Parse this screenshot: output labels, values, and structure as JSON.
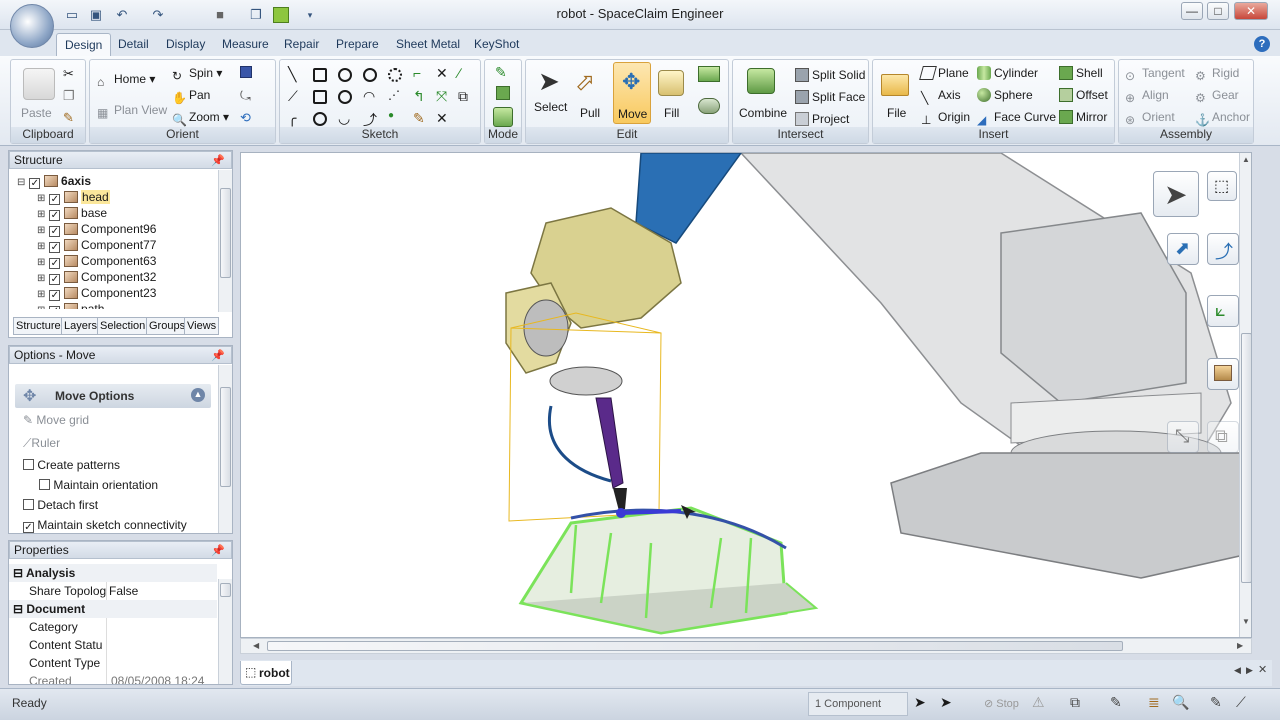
{
  "window": {
    "title": "robot - SpaceClaim Engineer",
    "minimize": "—",
    "maximize": "□",
    "close": "✕"
  },
  "quick_access": [
    "open-icon",
    "save-icon",
    "undo-icon",
    "redo-icon",
    "stop-icon",
    "copy-icon",
    "component-icon",
    "customize-icon"
  ],
  "tabs": [
    "Design",
    "Detail",
    "Display",
    "Measure",
    "Repair",
    "Prepare",
    "Sheet Metal",
    "KeyShot"
  ],
  "active_tab": "Design",
  "help": "?",
  "ribbon": {
    "clipboard": {
      "label": "Clipboard",
      "paste": "Paste"
    },
    "orient": {
      "label": "Orient",
      "home": "Home",
      "plan_view": "Plan View",
      "spin": "Spin",
      "pan": "Pan",
      "zoom": "Zoom"
    },
    "sketch": {
      "label": "Sketch"
    },
    "mode": {
      "label": "Mode"
    },
    "edit": {
      "label": "Edit",
      "select": "Select",
      "pull": "Pull",
      "move": "Move",
      "fill": "Fill"
    },
    "intersect": {
      "label": "Intersect",
      "combine": "Combine",
      "split_solid": "Split Solid",
      "split_face": "Split Face",
      "project": "Project"
    },
    "insert": {
      "label": "Insert",
      "file": "File",
      "plane": "Plane",
      "axis": "Axis",
      "origin": "Origin",
      "cylinder": "Cylinder",
      "sphere": "Sphere",
      "face_curve": "Face Curve",
      "shell": "Shell",
      "offset": "Offset",
      "mirror": "Mirror"
    },
    "assembly": {
      "label": "Assembly",
      "tangent": "Tangent",
      "align": "Align",
      "orient": "Orient",
      "rigid": "Rigid",
      "gear": "Gear",
      "anchor": "Anchor"
    }
  },
  "structure": {
    "title": "Structure",
    "root": "6axis",
    "items": [
      "head",
      "base",
      "Component96",
      "Component77",
      "Component63",
      "Component32",
      "Component23",
      "path"
    ],
    "selected": "head",
    "tabs": [
      "Structure",
      "Layers",
      "Selection",
      "Groups",
      "Views"
    ]
  },
  "options": {
    "title": "Options - Move",
    "header": "Move Options",
    "move_grid": "Move grid",
    "ruler": "Ruler",
    "create_patterns": "Create patterns",
    "maintain_orientation": "Maintain orientation",
    "detach_first": "Detach first",
    "maintain_sketch": "Maintain sketch connectivity",
    "create_patterns_checked": false,
    "maintain_orientation_checked": false,
    "detach_first_checked": false,
    "maintain_sketch_checked": true
  },
  "properties": {
    "title": "Properties",
    "sections": [
      {
        "name": "Analysis",
        "rows": [
          {
            "k": "Share Topolog",
            "v": "False"
          }
        ]
      },
      {
        "name": "Document",
        "rows": [
          {
            "k": "Category",
            "v": ""
          },
          {
            "k": "Content Statu",
            "v": ""
          },
          {
            "k": "Content Type",
            "v": ""
          },
          {
            "k": "Created",
            "v": "08/05/2008 18:24"
          }
        ]
      }
    ]
  },
  "document_tab": "robot",
  "status": {
    "left": "Ready",
    "components": "1 Component",
    "stop": "Stop"
  },
  "colors": {
    "accent": "#2d6dbd",
    "robot_blue": "#2a6fb4",
    "head_yellow": "#d9d190",
    "part_green": "#7be35a"
  }
}
